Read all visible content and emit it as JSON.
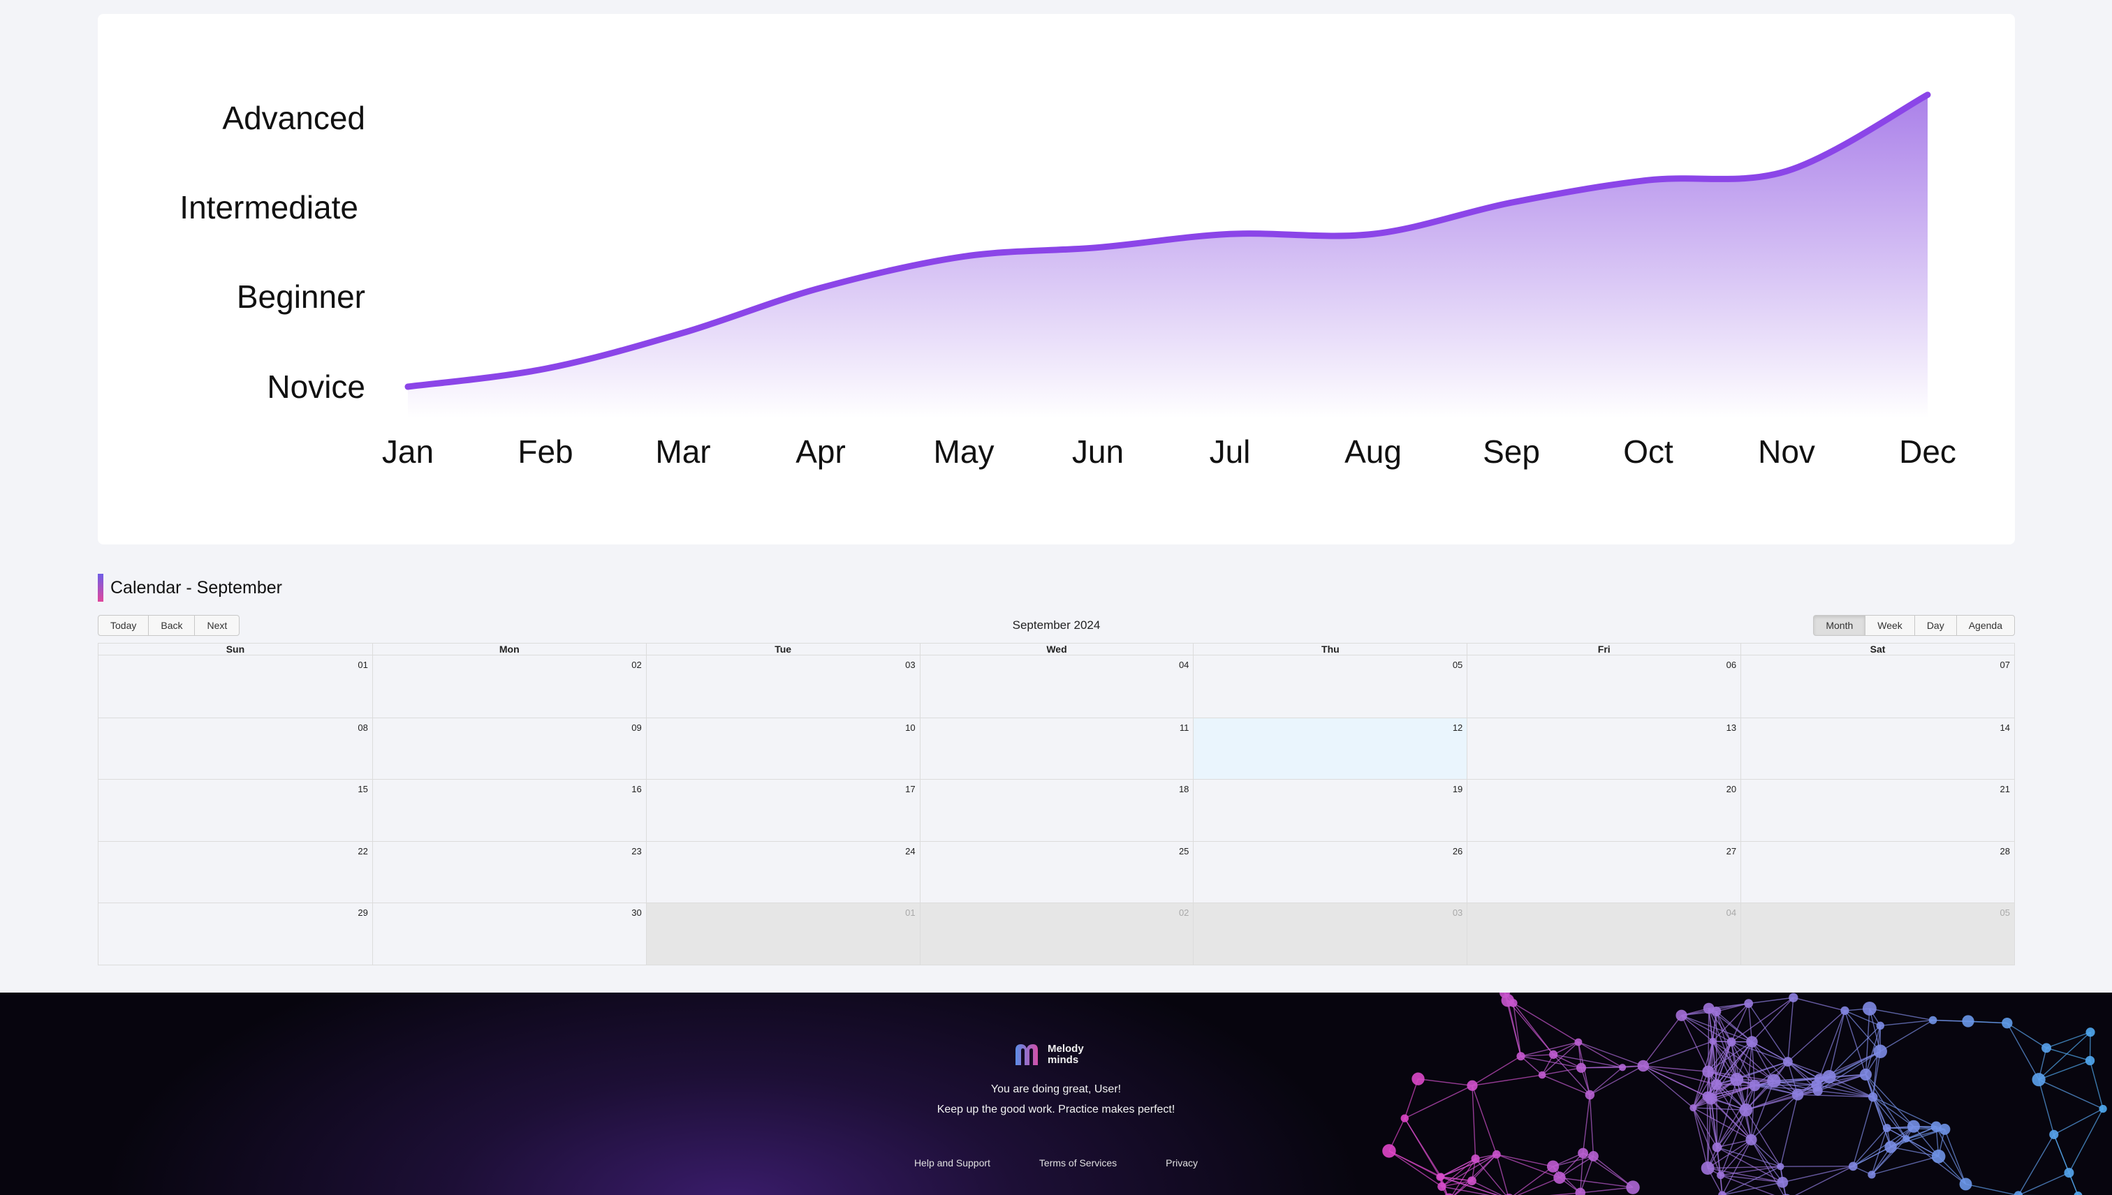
{
  "chart_data": {
    "type": "area",
    "x": [
      "Jan",
      "Feb",
      "Mar",
      "Apr",
      "May",
      "Jun",
      "Jul",
      "Aug",
      "Sep",
      "Oct",
      "Nov",
      "Dec"
    ],
    "y_categories": [
      "Novice",
      "Beginner",
      "Intermediate",
      "Advanced"
    ],
    "values": [
      0,
      0.2,
      0.6,
      1.1,
      1.45,
      1.55,
      1.7,
      1.7,
      2.05,
      2.3,
      2.4,
      3.25
    ],
    "ylim": [
      0,
      3
    ],
    "color": "#8b45e8",
    "fill_top": "#a67ae8",
    "fill_bottom": "#ffffff",
    "grid": false,
    "legend": "none"
  },
  "calendar": {
    "heading": "Calendar - September",
    "label": "September 2024",
    "nav_buttons": [
      "Today",
      "Back",
      "Next"
    ],
    "view_buttons": [
      "Month",
      "Week",
      "Day",
      "Agenda"
    ],
    "active_view": "Month",
    "weekdays": [
      "Sun",
      "Mon",
      "Tue",
      "Wed",
      "Thu",
      "Fri",
      "Sat"
    ],
    "weeks": [
      [
        "01",
        "02",
        "03",
        "04",
        "05",
        "06",
        "07"
      ],
      [
        "08",
        "09",
        "10",
        "11",
        "12",
        "13",
        "14"
      ],
      [
        "15",
        "16",
        "17",
        "18",
        "19",
        "20",
        "21"
      ],
      [
        "22",
        "23",
        "24",
        "25",
        "26",
        "27",
        "28"
      ],
      [
        "29",
        "30",
        "01",
        "02",
        "03",
        "04",
        "05"
      ]
    ],
    "today": "12",
    "off_range_cells": 5
  },
  "footer": {
    "logo_line1": "Melody",
    "logo_line2": "minds",
    "message_line1": "You are doing great, User!",
    "message_line2": "Keep up the good work. Practice makes perfect!",
    "links": [
      "Help and Support",
      "Terms of Services",
      "Privacy"
    ]
  }
}
